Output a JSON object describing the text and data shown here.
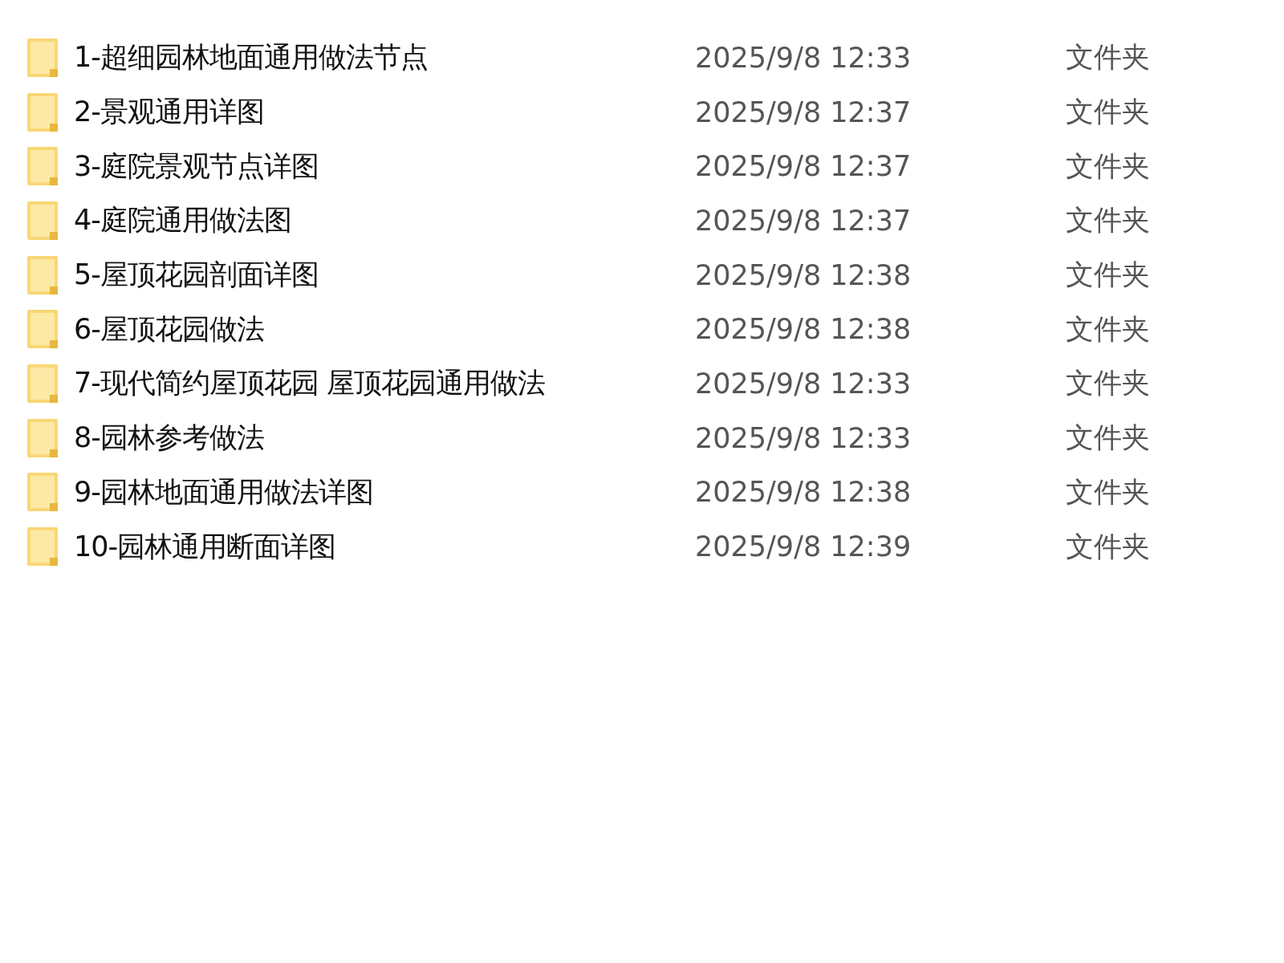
{
  "rows": [
    {
      "name": "1-超细园林地面通用做法节点",
      "date": "2025/9/8 12:33",
      "type": "文件夹"
    },
    {
      "name": "2-景观通用详图",
      "date": "2025/9/8 12:37",
      "type": "文件夹"
    },
    {
      "name": "3-庭院景观节点详图",
      "date": "2025/9/8 12:37",
      "type": "文件夹"
    },
    {
      "name": "4-庭院通用做法图",
      "date": "2025/9/8 12:37",
      "type": "文件夹"
    },
    {
      "name": "5-屋顶花园剖面详图",
      "date": "2025/9/8 12:38",
      "type": "文件夹"
    },
    {
      "name": "6-屋顶花园做法",
      "date": "2025/9/8 12:38",
      "type": "文件夹"
    },
    {
      "name": "7-现代简约屋顶花园 屋顶花园通用做法",
      "date": "2025/9/8 12:33",
      "type": "文件夹"
    },
    {
      "name": "8-园林参考做法",
      "date": "2025/9/8 12:33",
      "type": "文件夹"
    },
    {
      "name": "9-园林地面通用做法详图",
      "date": "2025/9/8 12:38",
      "type": "文件夹"
    },
    {
      "name": "10-园林通用断面详图",
      "date": "2025/9/8 12:39",
      "type": "文件夹"
    }
  ]
}
